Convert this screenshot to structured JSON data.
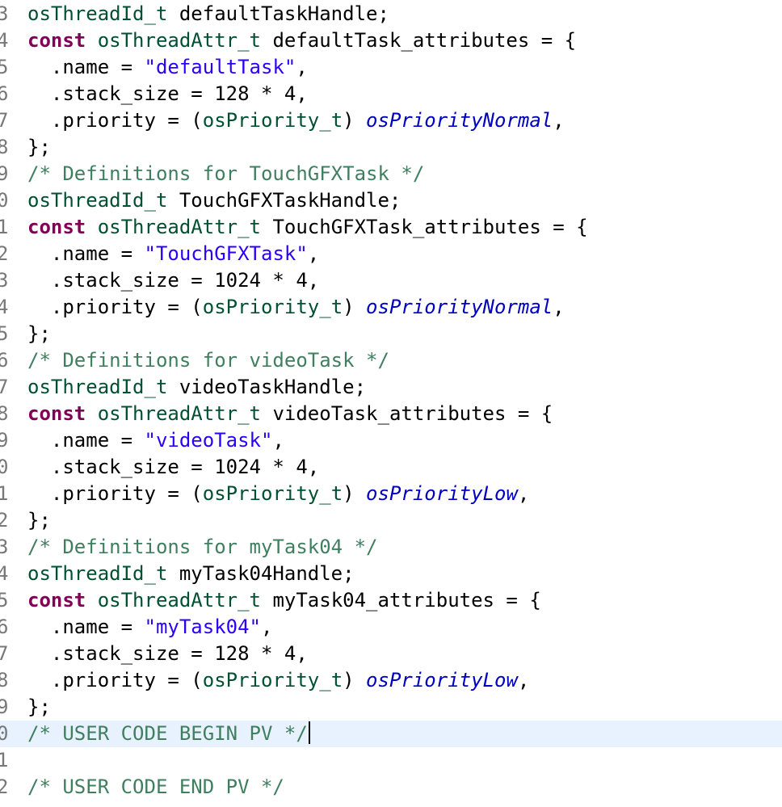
{
  "editor": {
    "current_line_index": 27,
    "colors": {
      "keyword": "#7f0055",
      "type": "#005032",
      "string": "#2a00ff",
      "comment": "#3f7f5f",
      "enum": "#0000c0",
      "line_number": "#787878",
      "current_line_bg": "#e8f2fe"
    },
    "lines": [
      {
        "num": "3",
        "tokens": [
          [
            "ty",
            "osThreadId_t"
          ],
          [
            "plain",
            " defaultTaskHandle;"
          ]
        ]
      },
      {
        "num": "4",
        "tokens": [
          [
            "kw",
            "const"
          ],
          [
            "plain",
            " "
          ],
          [
            "ty",
            "osThreadAttr_t"
          ],
          [
            "plain",
            " defaultTask_attributes = {"
          ]
        ]
      },
      {
        "num": "5",
        "tokens": [
          [
            "plain",
            "  .name = "
          ],
          [
            "str",
            "\"defaultTask\""
          ],
          [
            "plain",
            ","
          ]
        ]
      },
      {
        "num": "6",
        "tokens": [
          [
            "plain",
            "  .stack_size = 128 * 4,"
          ]
        ]
      },
      {
        "num": "7",
        "tokens": [
          [
            "plain",
            "  .priority = ("
          ],
          [
            "ty",
            "osPriority_t"
          ],
          [
            "plain",
            ") "
          ],
          [
            "en",
            "osPriorityNormal"
          ],
          [
            "plain",
            ","
          ]
        ]
      },
      {
        "num": "8",
        "tokens": [
          [
            "plain",
            "};"
          ]
        ]
      },
      {
        "num": "9",
        "tokens": [
          [
            "com",
            "/* Definitions for TouchGFXTask */"
          ]
        ]
      },
      {
        "num": "0",
        "tokens": [
          [
            "ty",
            "osThreadId_t"
          ],
          [
            "plain",
            " TouchGFXTaskHandle;"
          ]
        ]
      },
      {
        "num": "1",
        "tokens": [
          [
            "kw",
            "const"
          ],
          [
            "plain",
            " "
          ],
          [
            "ty",
            "osThreadAttr_t"
          ],
          [
            "plain",
            " TouchGFXTask_attributes = {"
          ]
        ]
      },
      {
        "num": "2",
        "tokens": [
          [
            "plain",
            "  .name = "
          ],
          [
            "str",
            "\"TouchGFXTask\""
          ],
          [
            "plain",
            ","
          ]
        ]
      },
      {
        "num": "3",
        "tokens": [
          [
            "plain",
            "  .stack_size = 1024 * 4,"
          ]
        ]
      },
      {
        "num": "4",
        "tokens": [
          [
            "plain",
            "  .priority = ("
          ],
          [
            "ty",
            "osPriority_t"
          ],
          [
            "plain",
            ") "
          ],
          [
            "en",
            "osPriorityNormal"
          ],
          [
            "plain",
            ","
          ]
        ]
      },
      {
        "num": "5",
        "tokens": [
          [
            "plain",
            "};"
          ]
        ]
      },
      {
        "num": "6",
        "tokens": [
          [
            "com",
            "/* Definitions for videoTask */"
          ]
        ]
      },
      {
        "num": "7",
        "tokens": [
          [
            "ty",
            "osThreadId_t"
          ],
          [
            "plain",
            " videoTaskHandle;"
          ]
        ]
      },
      {
        "num": "8",
        "tokens": [
          [
            "kw",
            "const"
          ],
          [
            "plain",
            " "
          ],
          [
            "ty",
            "osThreadAttr_t"
          ],
          [
            "plain",
            " videoTask_attributes = {"
          ]
        ]
      },
      {
        "num": "9",
        "tokens": [
          [
            "plain",
            "  .name = "
          ],
          [
            "str",
            "\"videoTask\""
          ],
          [
            "plain",
            ","
          ]
        ]
      },
      {
        "num": "0",
        "tokens": [
          [
            "plain",
            "  .stack_size = 1024 * 4,"
          ]
        ]
      },
      {
        "num": "1",
        "tokens": [
          [
            "plain",
            "  .priority = ("
          ],
          [
            "ty",
            "osPriority_t"
          ],
          [
            "plain",
            ") "
          ],
          [
            "en",
            "osPriorityLow"
          ],
          [
            "plain",
            ","
          ]
        ]
      },
      {
        "num": "2",
        "tokens": [
          [
            "plain",
            "};"
          ]
        ]
      },
      {
        "num": "3",
        "tokens": [
          [
            "com",
            "/* Definitions for myTask04 */"
          ]
        ]
      },
      {
        "num": "4",
        "tokens": [
          [
            "ty",
            "osThreadId_t"
          ],
          [
            "plain",
            " myTask04Handle;"
          ]
        ]
      },
      {
        "num": "5",
        "tokens": [
          [
            "kw",
            "const"
          ],
          [
            "plain",
            " "
          ],
          [
            "ty",
            "osThreadAttr_t"
          ],
          [
            "plain",
            " myTask04_attributes = {"
          ]
        ]
      },
      {
        "num": "6",
        "tokens": [
          [
            "plain",
            "  .name = "
          ],
          [
            "str",
            "\"myTask04\""
          ],
          [
            "plain",
            ","
          ]
        ]
      },
      {
        "num": "7",
        "tokens": [
          [
            "plain",
            "  .stack_size = 128 * 4,"
          ]
        ]
      },
      {
        "num": "8",
        "tokens": [
          [
            "plain",
            "  .priority = ("
          ],
          [
            "ty",
            "osPriority_t"
          ],
          [
            "plain",
            ") "
          ],
          [
            "en",
            "osPriorityLow"
          ],
          [
            "plain",
            ","
          ]
        ]
      },
      {
        "num": "9",
        "tokens": [
          [
            "plain",
            "};"
          ]
        ]
      },
      {
        "num": "0",
        "tokens": [
          [
            "com",
            "/* USER CODE BEGIN PV */"
          ]
        ]
      },
      {
        "num": "1",
        "tokens": []
      },
      {
        "num": "2",
        "tokens": [
          [
            "com",
            "/* USER CODE END PV */"
          ]
        ]
      }
    ]
  }
}
